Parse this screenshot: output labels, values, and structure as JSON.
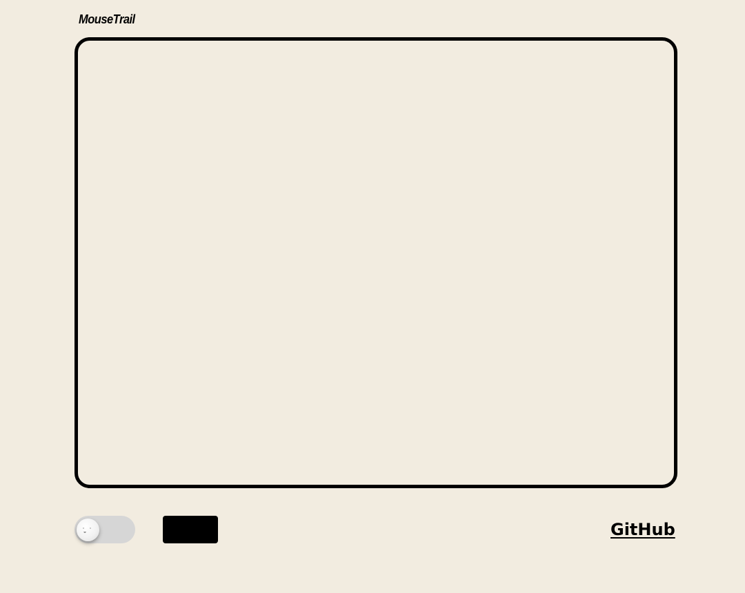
{
  "header": {
    "title": "MouseTrail"
  },
  "canvas": {
    "border_color": "#000000",
    "background": "#f2ece0"
  },
  "controls": {
    "toggle": {
      "state": "off",
      "icon": "sleepy-face-icon"
    },
    "button": {
      "label": ""
    }
  },
  "footer": {
    "github_label": "GitHub"
  },
  "colors": {
    "page_background": "#f2ece0",
    "toggle_track": "#d6d6d6",
    "button": "#000000",
    "text": "#000000"
  }
}
